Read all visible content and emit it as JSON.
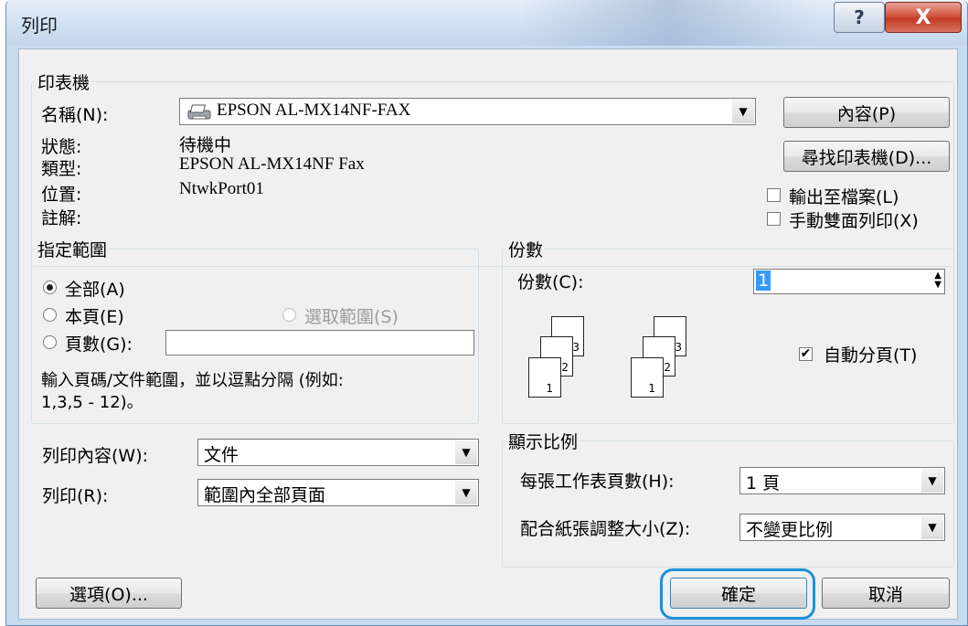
{
  "window": {
    "title": "列印",
    "help_glyph": "?",
    "close_glyph": "X"
  },
  "printer": {
    "group_label": "印表機",
    "name_label": "名稱(N):",
    "name_value": "EPSON AL-MX14NF-FAX",
    "status_label": "狀態:",
    "status_value": "待機中",
    "type_label": "類型:",
    "type_value": "EPSON AL-MX14NF Fax",
    "location_label": "位置:",
    "location_value": "NtwkPort01",
    "comment_label": "註解:",
    "properties_button": "內容(P)",
    "find_printer_button": "尋找印表機(D)...",
    "print_to_file_label": "輸出至檔案(L)",
    "print_to_file_checked": false,
    "manual_duplex_label": "手動雙面列印(X)",
    "manual_duplex_checked": false
  },
  "range": {
    "group_label": "指定範圍",
    "all_label": "全部(A)",
    "current_page_label": "本頁(E)",
    "selection_label": "選取範圍(S)",
    "pages_label": "頁數(G):",
    "pages_value": "",
    "selected": "all",
    "hint": "輸入頁碼/文件範圍，並以逗點分隔 (例如:",
    "hint_line2": "1,3,5 - 12)。"
  },
  "copies": {
    "group_label": "份數",
    "count_label": "份數(C):",
    "count_value": "1",
    "collate_label": "自動分頁(T)",
    "collate_checked": true,
    "stack_left": [
      "3",
      "2",
      "1"
    ],
    "stack_right": [
      "3",
      "2",
      "1"
    ]
  },
  "print_what": {
    "label": "列印內容(W):",
    "value": "文件",
    "print_label": "列印(R):",
    "print_value": "範圍內全部頁面"
  },
  "zoom": {
    "group_label": "顯示比例",
    "pages_per_sheet_label": "每張工作表頁數(H):",
    "pages_per_sheet_value": "1 頁",
    "scale_label": "配合紙張調整大小(Z):",
    "scale_value": "不變更比例"
  },
  "footer": {
    "options_button": "選項(O)...",
    "ok_button": "確定",
    "cancel_button": "取消",
    "highlight_color": "#1e90d6"
  }
}
